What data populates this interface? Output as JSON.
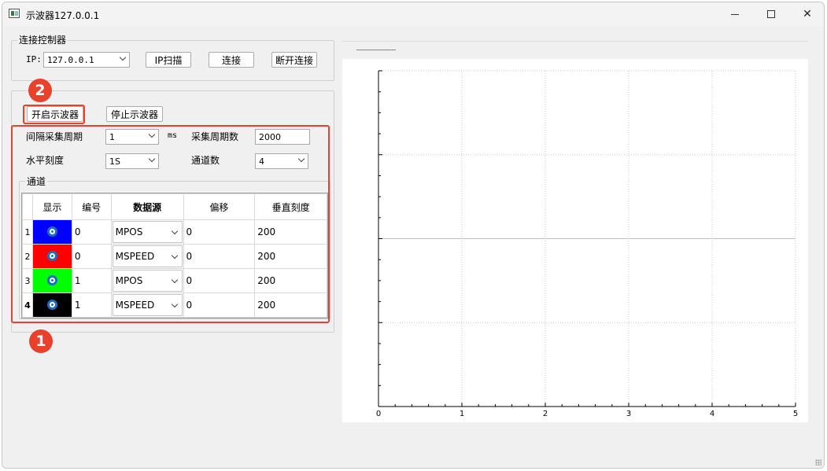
{
  "window": {
    "title": "示波器127.0.0.1"
  },
  "connection": {
    "group_title": "连接控制器",
    "ip_label": "IP:",
    "ip_value": "127.0.0.1",
    "scan_button": "IP扫描",
    "connect_button": "连接",
    "disconnect_button": "断开连接"
  },
  "scope": {
    "start_button": "开启示波器",
    "stop_button": "停止示波器",
    "interval_label": "间隔采集周期",
    "interval_value": "1",
    "interval_unit": "ms",
    "samples_label": "采集周期数",
    "samples_value": "2000",
    "horizontal_label": "水平刻度",
    "horizontal_value": "1S",
    "channels_label": "通道数",
    "channels_value": "4",
    "channel_group_title": "通道"
  },
  "table": {
    "headers": [
      "显示",
      "编号",
      "数据源",
      "偏移",
      "垂直刻度"
    ],
    "rows": [
      {
        "index": "1",
        "color": "#0000ff",
        "number": "0",
        "source": "MPOS",
        "offset": "0",
        "scale": "200"
      },
      {
        "index": "2",
        "color": "#ff0000",
        "number": "0",
        "source": "MSPEED",
        "offset": "0",
        "scale": "200"
      },
      {
        "index": "3",
        "color": "#00ff00",
        "number": "1",
        "source": "MPOS",
        "offset": "0",
        "scale": "200"
      },
      {
        "index": "4",
        "color": "#000000",
        "number": "1",
        "source": "MSPEED",
        "offset": "0",
        "scale": "200"
      }
    ]
  },
  "annotations": {
    "badge_1": "1",
    "badge_2": "2",
    "accent": "#e8412c"
  },
  "chart_data": {
    "type": "line",
    "title": "",
    "xlabel": "",
    "ylabel": "",
    "x_ticks": [
      "0",
      "1",
      "2",
      "3",
      "4",
      "5"
    ],
    "xlim": [
      0,
      5
    ],
    "grid": true,
    "series": []
  }
}
